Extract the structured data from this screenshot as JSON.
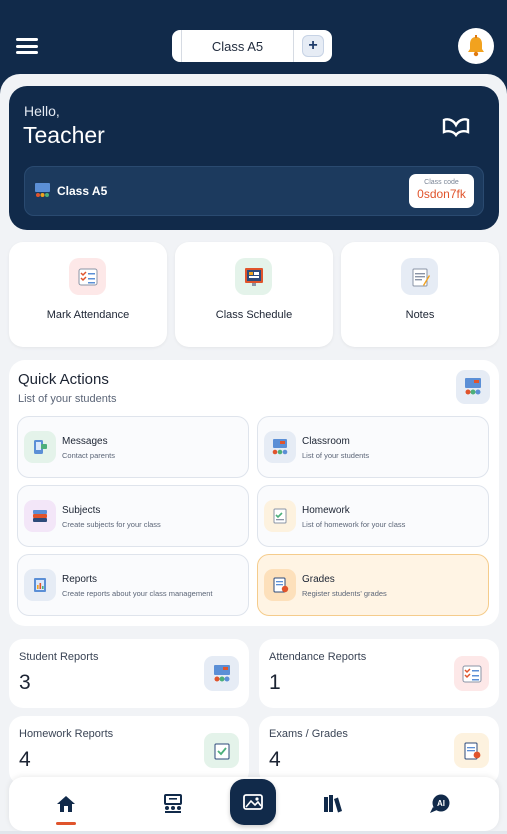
{
  "header": {
    "class_selector": "Class A5",
    "add_label": "+"
  },
  "hero": {
    "greeting": "Hello,",
    "user_name": "Teacher",
    "class_name": "Class A5",
    "class_code_label": "Class code",
    "class_code": "0sdon7fk"
  },
  "tiles": [
    {
      "label": "Mark Attendance",
      "icon": "attendance-checklist-icon"
    },
    {
      "label": "Class Schedule",
      "icon": "schedule-board-icon"
    },
    {
      "label": "Notes",
      "icon": "notes-icon"
    }
  ],
  "quick_actions": {
    "title": "Quick Actions",
    "subtitle": "List of your students",
    "items": [
      {
        "title": "Messages",
        "subtitle": "Contact parents",
        "icon": "messages-icon"
      },
      {
        "title": "Classroom",
        "subtitle": "List of your students",
        "icon": "classroom-icon"
      },
      {
        "title": "Subjects",
        "subtitle": "Create subjects for your class",
        "icon": "subjects-books-icon"
      },
      {
        "title": "Homework",
        "subtitle": "List of homework for your class",
        "icon": "homework-icon"
      },
      {
        "title": "Reports",
        "subtitle": "Create reports about your class management",
        "icon": "reports-icon"
      },
      {
        "title": "Grades",
        "subtitle": "Register students' grades",
        "icon": "grades-icon"
      }
    ]
  },
  "stats": [
    {
      "label": "Student Reports",
      "value": "3",
      "icon": "student-reports-icon"
    },
    {
      "label": "Attendance Reports",
      "value": "1",
      "icon": "attendance-reports-icon"
    },
    {
      "label": "Homework Reports",
      "value": "4",
      "icon": "homework-reports-icon"
    },
    {
      "label": "Exams / Grades",
      "value": "4",
      "icon": "exams-grades-icon"
    }
  ],
  "nav": [
    "home-icon",
    "classroom-nav-icon",
    "gallery-icon",
    "library-books-icon",
    "ai-chat-icon"
  ],
  "colors": {
    "navy": "#112a4a",
    "accent": "#e0542c",
    "highlight": "#fff4e4"
  }
}
